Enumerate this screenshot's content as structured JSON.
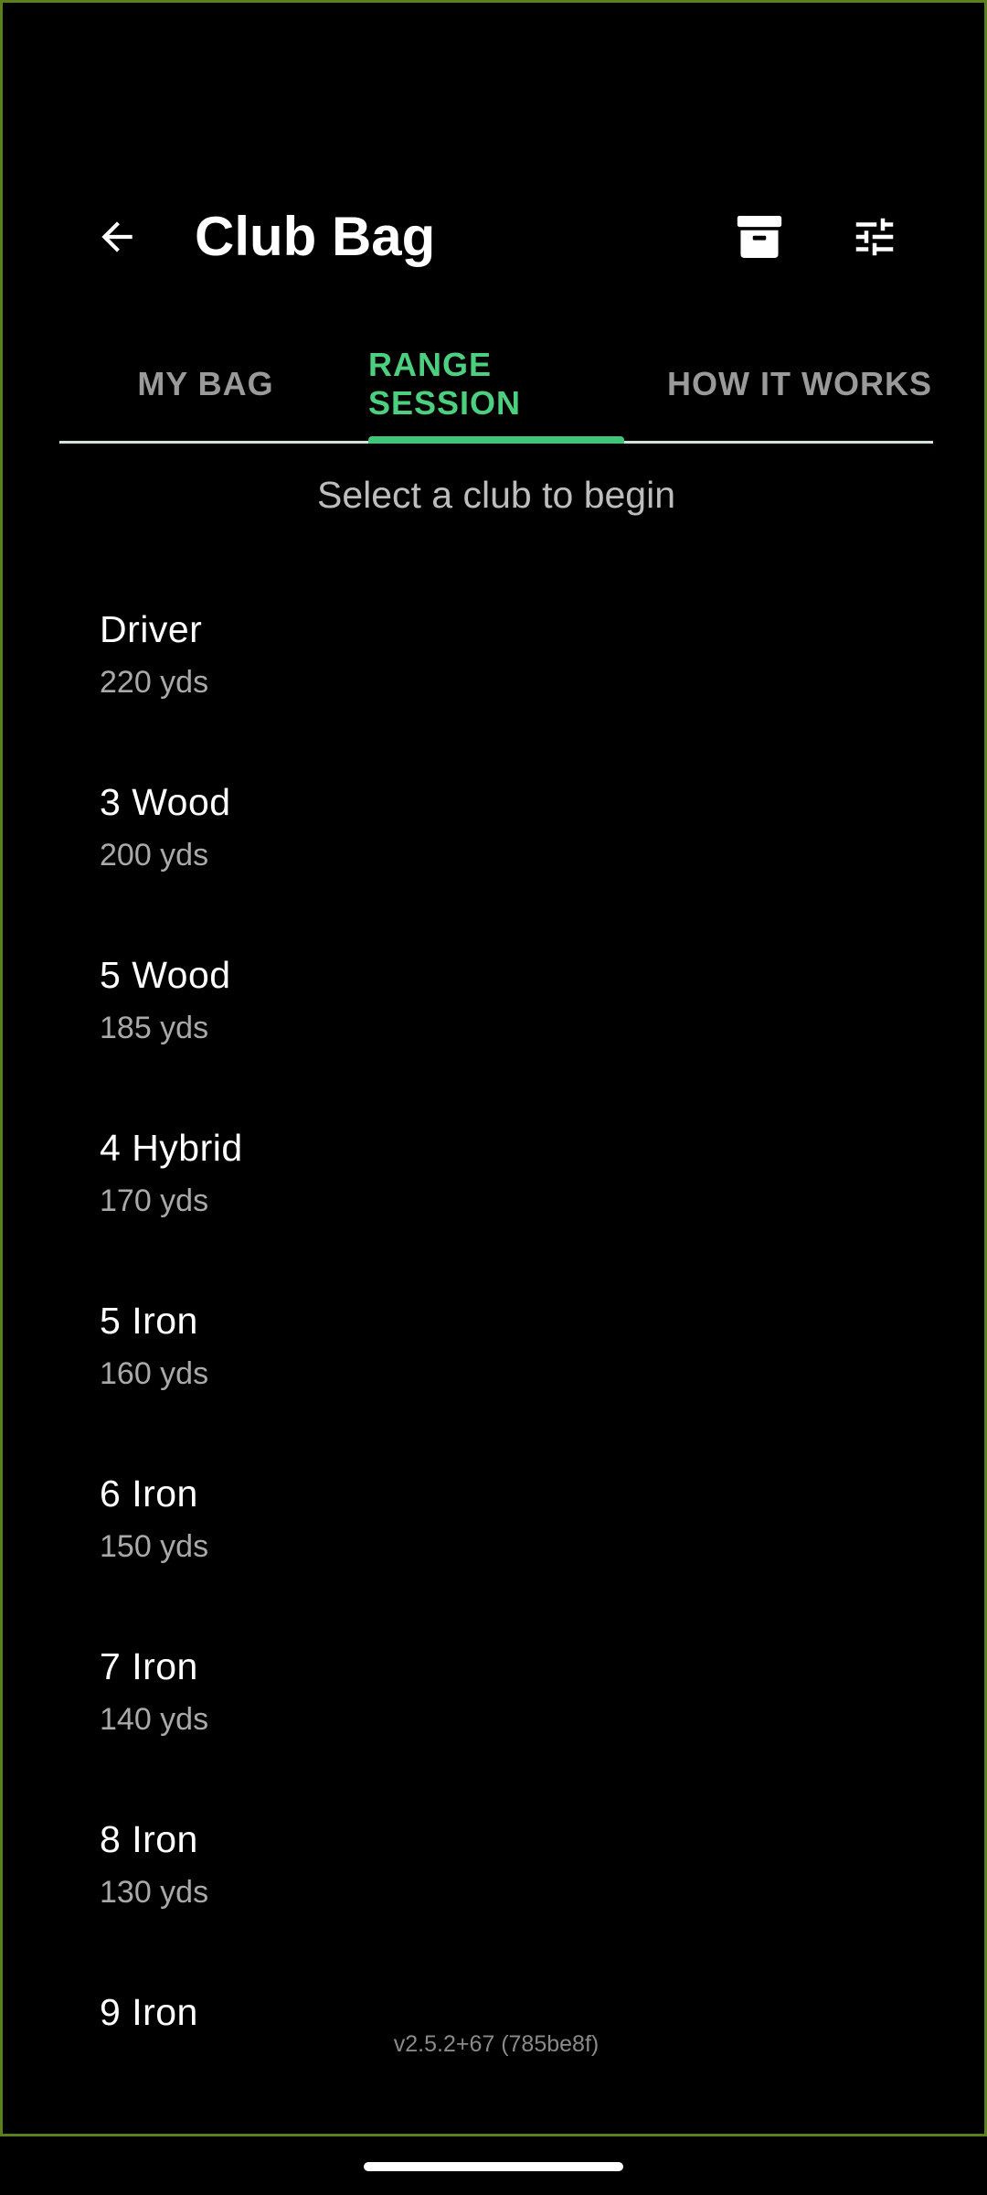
{
  "appbar": {
    "title": "Club Bag",
    "back_icon": "arrow-left-icon",
    "archive_icon": "archive-icon",
    "tune_icon": "tune-sliders-icon"
  },
  "tabs": [
    {
      "label": "MY BAG",
      "selected": false
    },
    {
      "label": "RANGE SESSION",
      "selected": true
    },
    {
      "label": "HOW IT WORKS",
      "selected": false
    }
  ],
  "colors": {
    "accent": "#3ec77a",
    "background": "#000000",
    "frame": "#5b7f1a"
  },
  "subtitle": "Select a club to begin",
  "clubs": [
    {
      "name": "Driver",
      "distance": "220 yds"
    },
    {
      "name": "3 Wood",
      "distance": "200 yds"
    },
    {
      "name": "5 Wood",
      "distance": "185 yds"
    },
    {
      "name": "4 Hybrid",
      "distance": "170 yds"
    },
    {
      "name": "5 Iron",
      "distance": "160 yds"
    },
    {
      "name": "6 Iron",
      "distance": "150 yds"
    },
    {
      "name": "7 Iron",
      "distance": "140 yds"
    },
    {
      "name": "8 Iron",
      "distance": "130 yds"
    },
    {
      "name": "9 Iron",
      "distance": ""
    }
  ],
  "version": "v2.5.2+67 (785be8f)"
}
